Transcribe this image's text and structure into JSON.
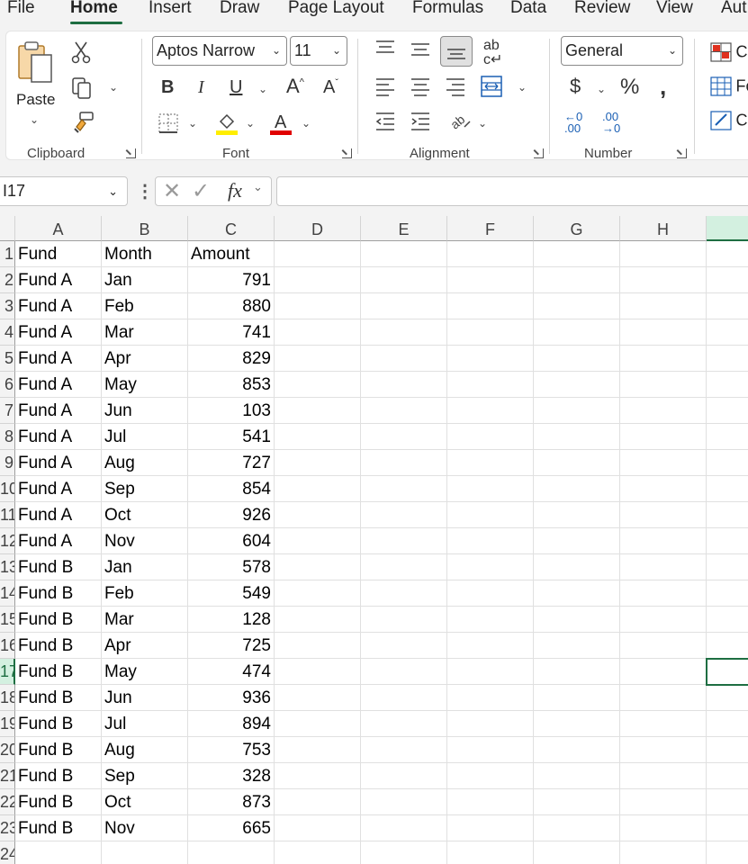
{
  "menu": {
    "tabs": [
      "File",
      "Home",
      "Insert",
      "Draw",
      "Page Layout",
      "Formulas",
      "Data",
      "Review",
      "View",
      "Aut"
    ],
    "active": "Home"
  },
  "ribbon": {
    "clipboard": {
      "label": "Clipboard",
      "paste_label": "Paste"
    },
    "font": {
      "label": "Font",
      "font_name": "Aptos Narrow",
      "font_size": "11"
    },
    "alignment": {
      "label": "Alignment"
    },
    "number": {
      "label": "Number",
      "format": "General"
    },
    "styles": {
      "items": [
        "Co",
        "Fo",
        "Ce"
      ]
    }
  },
  "formula_bar": {
    "name_box": "I17",
    "fx_label": "fx",
    "formula": ""
  },
  "columns": [
    "A",
    "B",
    "C",
    "D",
    "E",
    "F",
    "G",
    "H"
  ],
  "selected_cell": {
    "column": "I",
    "row": 17
  },
  "colors": {
    "accent": "#1e6e42",
    "font_underline": "#e00000",
    "highlight": "#ffee00"
  },
  "sheet": {
    "header": [
      "Fund",
      "Month",
      "Amount"
    ],
    "rows": [
      [
        "Fund A",
        "Jan",
        "791"
      ],
      [
        "Fund A",
        "Feb",
        "880"
      ],
      [
        "Fund A",
        "Mar",
        "741"
      ],
      [
        "Fund A",
        "Apr",
        "829"
      ],
      [
        "Fund A",
        "May",
        "853"
      ],
      [
        "Fund A",
        "Jun",
        "103"
      ],
      [
        "Fund A",
        "Jul",
        "541"
      ],
      [
        "Fund A",
        "Aug",
        "727"
      ],
      [
        "Fund A",
        "Sep",
        "854"
      ],
      [
        "Fund A",
        "Oct",
        "926"
      ],
      [
        "Fund A",
        "Nov",
        "604"
      ],
      [
        "Fund B",
        "Jan",
        "578"
      ],
      [
        "Fund B",
        "Feb",
        "549"
      ],
      [
        "Fund B",
        "Mar",
        "128"
      ],
      [
        "Fund B",
        "Apr",
        "725"
      ],
      [
        "Fund B",
        "May",
        "474"
      ],
      [
        "Fund B",
        "Jun",
        "936"
      ],
      [
        "Fund B",
        "Jul",
        "894"
      ],
      [
        "Fund B",
        "Aug",
        "753"
      ],
      [
        "Fund B",
        "Sep",
        "328"
      ],
      [
        "Fund B",
        "Oct",
        "873"
      ],
      [
        "Fund B",
        "Nov",
        "665"
      ]
    ],
    "row_numbers": [
      "1",
      "2",
      "3",
      "4",
      "5",
      "6",
      "7",
      "8",
      "9",
      "10",
      "11",
      "12",
      "13",
      "14",
      "15",
      "16",
      "17",
      "18",
      "19",
      "20",
      "21",
      "22",
      "23",
      "24"
    ]
  }
}
